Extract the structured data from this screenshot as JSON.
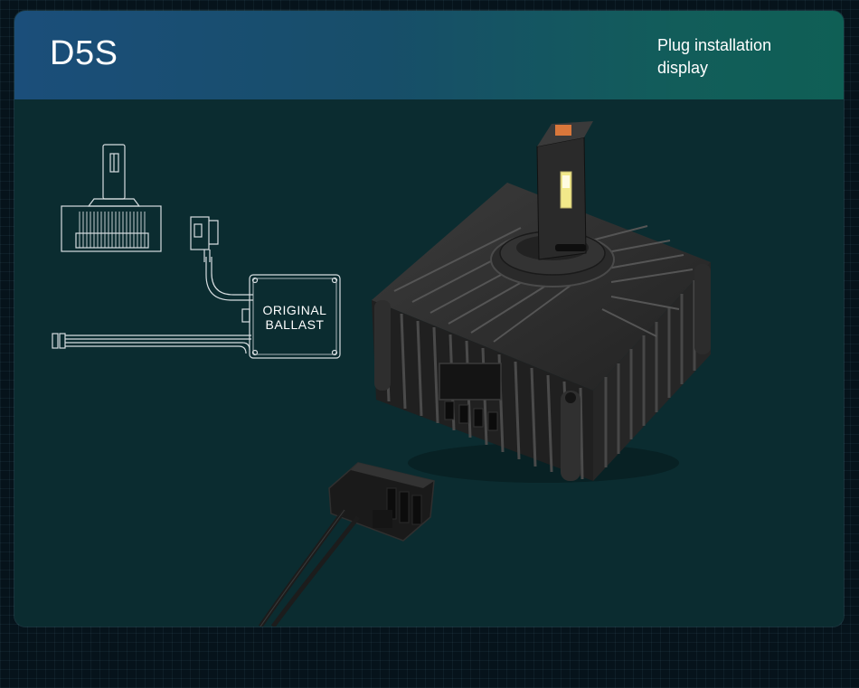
{
  "header": {
    "title": "D5S",
    "subtitle": "Plug installation display"
  },
  "diagram": {
    "ballast_line1": "ORIGINAL",
    "ballast_line2": "BALLAST"
  },
  "colors": {
    "card_background": "#0b2c30",
    "header_left": "#1b4e7a",
    "header_right": "#0f5f55",
    "line_art": "#d7dde0",
    "heatsink": "#2b2b2b",
    "led_chip": "#f2e98a",
    "accent_copper": "#d9773b"
  },
  "icons": [
    "bulb-outline-icon",
    "connector-outline-icon",
    "ballast-box-icon",
    "wire-harness-icon",
    "led-bulb-product-image",
    "plug-connector-image"
  ]
}
